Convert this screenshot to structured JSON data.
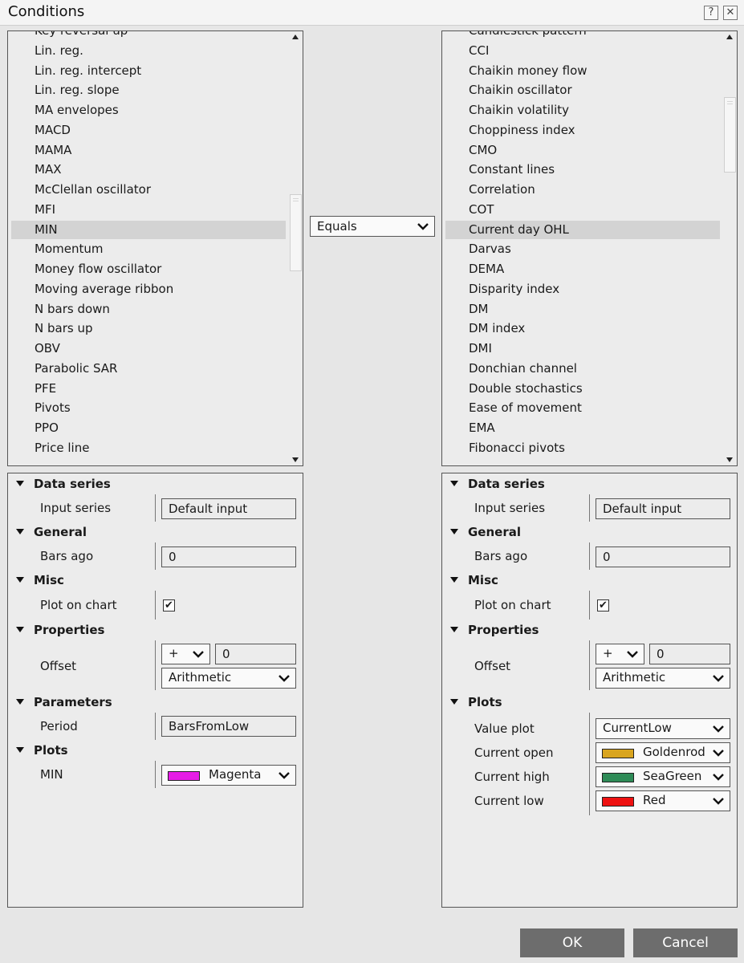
{
  "window": {
    "title": "Conditions",
    "help_glyph": "?",
    "close_glyph": "✕"
  },
  "left_list": {
    "items": [
      "Key reversal up",
      "Lin. reg.",
      "Lin. reg. intercept",
      "Lin. reg. slope",
      "MA envelopes",
      "MACD",
      "MAMA",
      "MAX",
      "McClellan oscillator",
      "MFI",
      "MIN",
      "Momentum",
      "Money flow oscillator",
      "Moving average ribbon",
      "N bars down",
      "N bars up",
      "OBV",
      "Parabolic SAR",
      "PFE",
      "Pivots",
      "PPO",
      "Price line"
    ],
    "selected_index": 10
  },
  "right_list": {
    "items": [
      "Candlestick pattern",
      "CCI",
      "Chaikin money flow",
      "Chaikin oscillator",
      "Chaikin volatility",
      "Choppiness index",
      "CMO",
      "Constant lines",
      "Correlation",
      "COT",
      "Current day OHL",
      "Darvas",
      "DEMA",
      "Disparity index",
      "DM",
      "DM index",
      "DMI",
      "Donchian channel",
      "Double stochastics",
      "Ease of movement",
      "EMA",
      "Fibonacci pivots"
    ],
    "selected_index": 10
  },
  "condition": {
    "selected": "Equals"
  },
  "left_props": {
    "data_series": "Data series",
    "input_series_label": "Input series",
    "input_series_value": "Default input",
    "general": "General",
    "bars_ago_label": "Bars ago",
    "bars_ago_value": "0",
    "misc": "Misc",
    "plot_on_chart_label": "Plot on chart",
    "plot_on_chart_check": "✔",
    "properties": "Properties",
    "offset_label": "Offset",
    "offset_sign": "+",
    "offset_value": "0",
    "offset_type": "Arithmetic",
    "parameters": "Parameters",
    "period_label": "Period",
    "period_value": "BarsFromLow",
    "plots": "Plots",
    "min_label": "MIN",
    "min_color_name": "Magenta",
    "min_color": "#e61ce6"
  },
  "right_props": {
    "data_series": "Data series",
    "input_series_label": "Input series",
    "input_series_value": "Default input",
    "general": "General",
    "bars_ago_label": "Bars ago",
    "bars_ago_value": "0",
    "misc": "Misc",
    "plot_on_chart_label": "Plot on chart",
    "plot_on_chart_check": "✔",
    "properties": "Properties",
    "offset_label": "Offset",
    "offset_sign": "+",
    "offset_value": "0",
    "offset_type": "Arithmetic",
    "plots": "Plots",
    "value_plot_label": "Value plot",
    "value_plot_value": "CurrentLow",
    "current_open_label": "Current open",
    "current_open_color_name": "Goldenrod",
    "current_open_color": "#d9a51f",
    "current_high_label": "Current high",
    "current_high_color_name": "SeaGreen",
    "current_high_color": "#2e8b57",
    "current_low_label": "Current low",
    "current_low_color_name": "Red",
    "current_low_color": "#ee1111"
  },
  "buttons": {
    "ok": "OK",
    "cancel": "Cancel"
  }
}
